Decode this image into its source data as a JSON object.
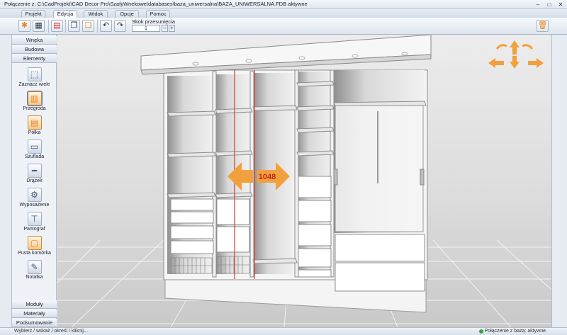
{
  "window": {
    "title": "Połączenie z: C:\\CadProjekt\\CAD Decor Pro\\SzafyWnekowe\\databases\\baza_uniwersalna\\BAZA_UNIWERSALNA.FDB aktywne",
    "minimize": "–",
    "maximize": "□",
    "close": "✕"
  },
  "menu": {
    "tabs": [
      {
        "label": "Projekt"
      },
      {
        "label": "Edycja"
      },
      {
        "label": "Widok"
      },
      {
        "label": "Opcje"
      },
      {
        "label": "Pomoc"
      }
    ],
    "active": "Edycja"
  },
  "toolbar": {
    "skok_label": "Skok przesunięcia",
    "skok_value": "1",
    "minus": "–",
    "plus": "+"
  },
  "sidebar": {
    "top_headers": [
      "Wnęka",
      "Budowa",
      "Elementy"
    ],
    "tools": [
      {
        "label": "Zaznacz wiele"
      },
      {
        "label": "Przegroda"
      },
      {
        "label": "Półka"
      },
      {
        "label": "Szuflada"
      },
      {
        "label": "Drążek"
      },
      {
        "label": "Wyposażenie"
      },
      {
        "label": "Pantograf"
      },
      {
        "label": "Pusta komórka"
      },
      {
        "label": "Notatka"
      }
    ],
    "bottom_headers": [
      "Moduły",
      "Materiały",
      "Podsumowanie"
    ]
  },
  "viewport": {
    "dimension_value": "1048"
  },
  "status": {
    "left": "Wybierz / wskaż / określ / kliknij...",
    "right": "Połączenie z bazą: aktywne"
  },
  "colors": {
    "accent": "#f2a03d",
    "dimension_text": "#c0281e",
    "floor": "#cfcfcf"
  }
}
